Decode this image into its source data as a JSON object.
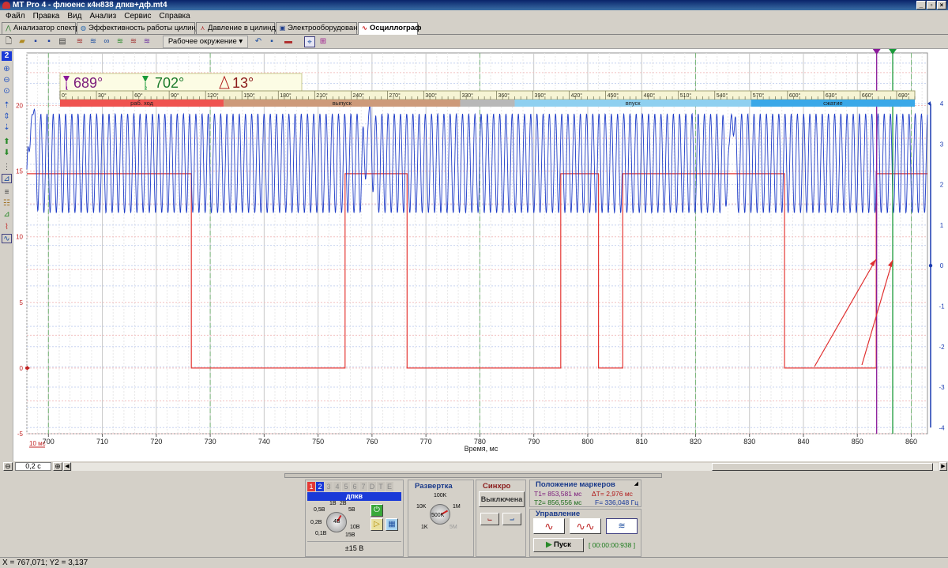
{
  "window": {
    "title": "MT Pro 4 - флюенс к4н838 дпкв+дф.mt4"
  },
  "menu": [
    "Файл",
    "Правка",
    "Вид",
    "Анализ",
    "Сервис",
    "Справка"
  ],
  "tabs": [
    "Анализатор спектра",
    "Эффективность работы цилиндров",
    "Давление в цилиндре",
    "Электрооборудование",
    "Осциллограф"
  ],
  "toolbar": {
    "environment": "Рабочее окружение"
  },
  "left_tools": {
    "channel_number": "2"
  },
  "angles": {
    "t1": "689°",
    "t2": "702°",
    "delta": "13°",
    "t1_sub": "1",
    "t2_sub": "2"
  },
  "degree_scale": [
    "0°",
    "30°",
    "60°",
    "90°",
    "120°",
    "150°",
    "180°",
    "210°",
    "240°",
    "270°",
    "300°",
    "330°",
    "360°",
    "390°",
    "420°",
    "450°",
    "480°",
    "510°",
    "540°",
    "570°",
    "600°",
    "630°",
    "660°",
    "690°"
  ],
  "strokes": [
    {
      "label": "раб. ход",
      "color": "#ef5350",
      "from": 0,
      "to": 135
    },
    {
      "label": "выпуск",
      "color": "#cd9a7a",
      "from": 135,
      "to": 330
    },
    {
      "label": "",
      "color": "#b8b8b8",
      "from": 330,
      "to": 375
    },
    {
      "label": "впуск",
      "color": "#8fd0f0",
      "from": 375,
      "to": 570
    },
    {
      "label": "сжатие",
      "color": "#3aa8e8",
      "from": 570,
      "to": 705
    }
  ],
  "left_axis_ticks": [
    "20",
    "15",
    "10",
    "5",
    "0",
    "-5"
  ],
  "right_axis_ticks": [
    "4",
    "3",
    "2",
    "1",
    "0",
    "-1",
    "-2",
    "-3",
    "-4"
  ],
  "x_ticks": [
    "700",
    "710",
    "720",
    "730",
    "740",
    "750",
    "760",
    "770",
    "780",
    "790",
    "800",
    "810",
    "820",
    "830",
    "840",
    "850",
    "860"
  ],
  "x_label": "Время, мс",
  "scale_label": "10 мс",
  "timebase": "0,2 с",
  "marker_t1_ms": 853.581,
  "marker_t2_ms": 856.556,
  "chart_data": {
    "type": "line",
    "xlabel": "Время, мс",
    "xlim": [
      696,
      863
    ],
    "series": [
      {
        "axis": "left",
        "ylim": [
          -5,
          24
        ],
        "color": "#e53935",
        "segments": [
          [
            696,
            14.8
          ],
          [
            726.5,
            14.8
          ],
          [
            726.5,
            0
          ],
          [
            755,
            0
          ],
          [
            755,
            14.8
          ],
          [
            766.5,
            14.8
          ],
          [
            766.5,
            0
          ],
          [
            795,
            0
          ],
          [
            795,
            14.8
          ],
          [
            802,
            14.8
          ],
          [
            802,
            0
          ],
          [
            806.5,
            0
          ],
          [
            806.5,
            14.8
          ],
          [
            836.5,
            14.8
          ],
          [
            836.5,
            0
          ],
          [
            853.5,
            0
          ],
          [
            853.5,
            14.8
          ],
          [
            863,
            14.8
          ]
        ]
      },
      {
        "axis": "right",
        "ylim": [
          -4.15,
          5.25
        ],
        "color": "#1e3cc8",
        "period_ms": 1.15,
        "low": 1.3,
        "high": 3.75,
        "gap_ms": [
          696.8,
          759.3,
          826.5
        ]
      }
    ]
  },
  "channel_panel": {
    "tabs": [
      "1",
      "2",
      "3",
      "4",
      "5",
      "6",
      "7",
      "D",
      "T",
      "E"
    ],
    "name": "дпкв",
    "knob_labels": [
      "1В",
      "2В",
      "0,5В",
      "5В",
      "0,2В",
      "4В",
      "10В",
      "0,1В",
      "15В"
    ],
    "range": "±15 В"
  },
  "sweep_panel": {
    "title": "Развертка",
    "labels": [
      "100K",
      "10K",
      "1M",
      "1K",
      "500K",
      "5M"
    ]
  },
  "sync_panel": {
    "title": "Синхро",
    "value": "Выключена"
  },
  "markers_panel": {
    "title": "Положение маркеров",
    "t1": "T1= 853,581 мс",
    "dt": "ΔT= 2,976 мс",
    "t2": "T2= 856,556 мс",
    "f": "F= 336,048 Гц"
  },
  "control_panel": {
    "title": "Управление",
    "start": "Пуск",
    "timer": "[ 00:00:00:938 ]"
  },
  "status": "X = 767,071; Y2 = 3,137"
}
